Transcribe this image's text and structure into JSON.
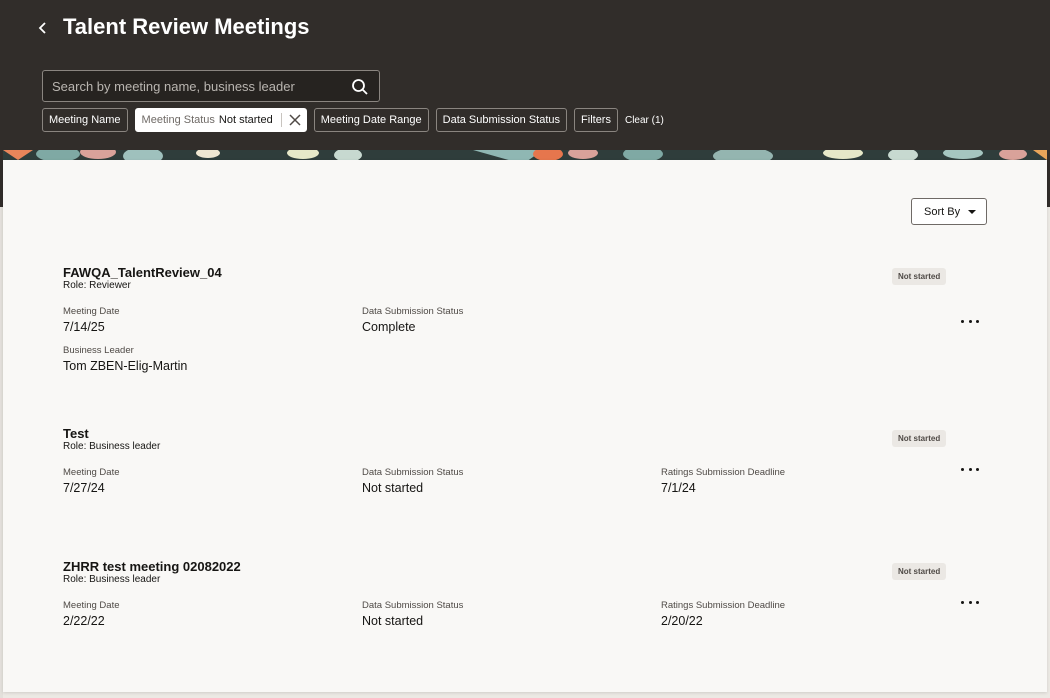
{
  "header": {
    "title": "Talent Review Meetings",
    "back_icon": "chevron-left-icon"
  },
  "search": {
    "placeholder": "Search by meeting name, business leader",
    "value": "",
    "icon": "search-icon"
  },
  "filters": {
    "meeting_name": "Meeting Name",
    "meeting_status_key": "Meeting Status",
    "meeting_status_value": "Not started",
    "meeting_date_range": "Meeting Date Range",
    "data_submission_status": "Data Submission Status",
    "filters": "Filters",
    "clear": "Clear (1)"
  },
  "sort": {
    "label": "Sort By"
  },
  "meetings": [
    {
      "title": "FAWQA_TalentReview_04",
      "role": "Role: Reviewer",
      "status": "Not started",
      "meeting_date_label": "Meeting Date",
      "meeting_date": "7/14/25",
      "data_submission_label": "Data Submission Status",
      "data_submission": "Complete",
      "business_leader_label": "Business Leader",
      "business_leader": "Tom ZBEN-Elig-Martin"
    },
    {
      "title": "Test",
      "role": "Role: Business leader",
      "status": "Not started",
      "meeting_date_label": "Meeting Date",
      "meeting_date": "7/27/24",
      "data_submission_label": "Data Submission Status",
      "data_submission": "Not started",
      "deadline_label": "Ratings Submission Deadline",
      "deadline": "7/1/24"
    },
    {
      "title": "ZHRR test meeting 02082022",
      "role": "Role: Business leader",
      "status": "Not started",
      "meeting_date_label": "Meeting Date",
      "meeting_date": "2/22/22",
      "data_submission_label": "Data Submission Status",
      "data_submission": "Not started",
      "deadline_label": "Ratings Submission Deadline",
      "deadline": "2/20/22"
    }
  ],
  "colors": {
    "header_bg": "#312d2a",
    "panel_bg": "#f9f8f6",
    "badge_bg": "#ebe8e4"
  }
}
